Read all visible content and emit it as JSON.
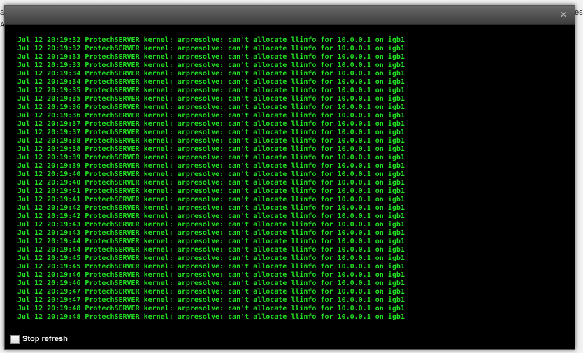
{
  "background": {
    "left_glyph_top": "a",
    "left_glyph_bottom": "A",
    "right_glyph": "es"
  },
  "dialog": {
    "close_icon": "close-icon",
    "colors": {
      "log_text": "#22e022",
      "log_background": "#000000"
    }
  },
  "log": {
    "lines": [
      "Jul 12 20:19:32 ProtechSERVER kernel: arpresolve: can't allocate llinfo for 10.0.0.1 on igb1",
      "Jul 12 20:19:32 ProtechSERVER kernel: arpresolve: can't allocate llinfo for 10.0.0.1 on igb1",
      "Jul 12 20:19:33 ProtechSERVER kernel: arpresolve: can't allocate llinfo for 10.0.0.1 on igb1",
      "Jul 12 20:19:33 ProtechSERVER kernel: arpresolve: can't allocate llinfo for 10.0.0.1 on igb1",
      "Jul 12 20:19:34 ProtechSERVER kernel: arpresolve: can't allocate llinfo for 10.0.0.1 on igb1",
      "Jul 12 20:19:34 ProtechSERVER kernel: arpresolve: can't allocate llinfo for 10.0.0.1 on igb1",
      "Jul 12 20:19:35 ProtechSERVER kernel: arpresolve: can't allocate llinfo for 10.0.0.1 on igb1",
      "Jul 12 20:19:35 ProtechSERVER kernel: arpresolve: can't allocate llinfo for 10.0.0.1 on igb1",
      "Jul 12 20:19:36 ProtechSERVER kernel: arpresolve: can't allocate llinfo for 10.0.0.1 on igb1",
      "Jul 12 20:19:36 ProtechSERVER kernel: arpresolve: can't allocate llinfo for 10.0.0.1 on igb1",
      "Jul 12 20:19:37 ProtechSERVER kernel: arpresolve: can't allocate llinfo for 10.0.0.1 on igb1",
      "Jul 12 20:19:37 ProtechSERVER kernel: arpresolve: can't allocate llinfo for 10.0.0.1 on igb1",
      "Jul 12 20:19:38 ProtechSERVER kernel: arpresolve: can't allocate llinfo for 10.0.0.1 on igb1",
      "Jul 12 20:19:38 ProtechSERVER kernel: arpresolve: can't allocate llinfo for 10.0.0.1 on igb1",
      "Jul 12 20:19:39 ProtechSERVER kernel: arpresolve: can't allocate llinfo for 10.0.0.1 on igb1",
      "Jul 12 20:19:39 ProtechSERVER kernel: arpresolve: can't allocate llinfo for 10.0.0.1 on igb1",
      "Jul 12 20:19:40 ProtechSERVER kernel: arpresolve: can't allocate llinfo for 10.0.0.1 on igb1",
      "Jul 12 20:19:40 ProtechSERVER kernel: arpresolve: can't allocate llinfo for 10.0.0.1 on igb1",
      "Jul 12 20:19:41 ProtechSERVER kernel: arpresolve: can't allocate llinfo for 10.0.0.1 on igb1",
      "Jul 12 20:19:41 ProtechSERVER kernel: arpresolve: can't allocate llinfo for 10.0.0.1 on igb1",
      "Jul 12 20:19:42 ProtechSERVER kernel: arpresolve: can't allocate llinfo for 10.0.0.1 on igb1",
      "Jul 12 20:19:42 ProtechSERVER kernel: arpresolve: can't allocate llinfo for 10.0.0.1 on igb1",
      "Jul 12 20:19:43 ProtechSERVER kernel: arpresolve: can't allocate llinfo for 10.0.0.1 on igb1",
      "Jul 12 20:19:43 ProtechSERVER kernel: arpresolve: can't allocate llinfo for 10.0.0.1 on igb1",
      "Jul 12 20:19:44 ProtechSERVER kernel: arpresolve: can't allocate llinfo for 10.0.0.1 on igb1",
      "Jul 12 20:19:44 ProtechSERVER kernel: arpresolve: can't allocate llinfo for 10.0.0.1 on igb1",
      "Jul 12 20:19:45 ProtechSERVER kernel: arpresolve: can't allocate llinfo for 10.0.0.1 on igb1",
      "Jul 12 20:19:45 ProtechSERVER kernel: arpresolve: can't allocate llinfo for 10.0.0.1 on igb1",
      "Jul 12 20:19:46 ProtechSERVER kernel: arpresolve: can't allocate llinfo for 10.0.0.1 on igb1",
      "Jul 12 20:19:46 ProtechSERVER kernel: arpresolve: can't allocate llinfo for 10.0.0.1 on igb1",
      "Jul 12 20:19:47 ProtechSERVER kernel: arpresolve: can't allocate llinfo for 10.0.0.1 on igb1",
      "Jul 12 20:19:47 ProtechSERVER kernel: arpresolve: can't allocate llinfo for 10.0.0.1 on igb1",
      "Jul 12 20:19:48 ProtechSERVER kernel: arpresolve: can't allocate llinfo for 10.0.0.1 on igb1",
      "Jul 12 20:19:48 ProtechSERVER kernel: arpresolve: can't allocate llinfo for 10.0.0.1 on igb1"
    ]
  },
  "footer": {
    "stop_refresh_label": "Stop refresh",
    "stop_refresh_checked": false
  }
}
